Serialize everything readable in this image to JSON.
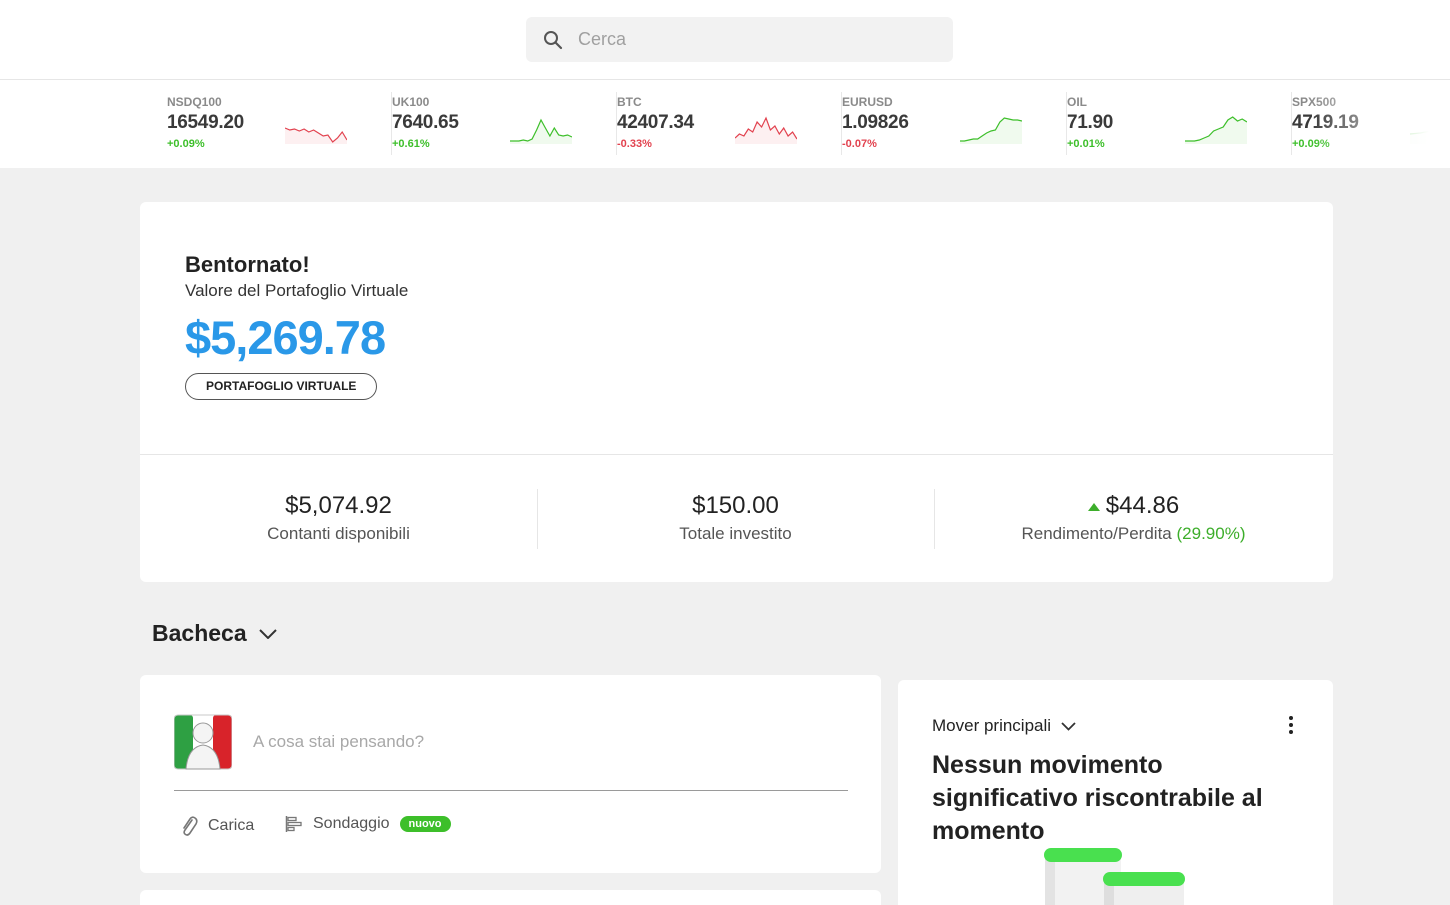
{
  "search": {
    "placeholder": "Cerca"
  },
  "ticker": [
    {
      "symbol": "NSDQ100",
      "price": "16549.20",
      "change": "+0.09%",
      "direction": "up",
      "spark_color": "#e2424f",
      "spark": [
        14,
        16,
        15,
        17,
        15,
        18,
        16,
        19,
        22,
        21,
        28,
        24,
        18,
        26
      ]
    },
    {
      "symbol": "UK100",
      "price": "7640.65",
      "change": "+0.61%",
      "direction": "up",
      "spark_color": "#3dbf2a",
      "spark": [
        27,
        27,
        27,
        26,
        27,
        25,
        16,
        6,
        14,
        22,
        14,
        21,
        22,
        21,
        23
      ]
    },
    {
      "symbol": "BTC",
      "price": "42407.34",
      "change": "-0.33%",
      "direction": "down",
      "spark_color": "#e2424f",
      "spark": [
        24,
        20,
        22,
        15,
        18,
        8,
        13,
        4,
        16,
        12,
        20,
        14,
        22,
        18,
        25
      ]
    },
    {
      "symbol": "EURUSD",
      "price": "1.09826",
      "change": "-0.07%",
      "direction": "down",
      "spark_color": "#3dbf2a",
      "spark": [
        27,
        27,
        26,
        25,
        25,
        22,
        19,
        17,
        16,
        8,
        4,
        5,
        6,
        6,
        7
      ]
    },
    {
      "symbol": "OIL",
      "price": "71.90",
      "change": "+0.01%",
      "direction": "up",
      "spark_color": "#3dbf2a",
      "spark": [
        27,
        27,
        27,
        26,
        24,
        22,
        17,
        15,
        13,
        6,
        3,
        7,
        5,
        8
      ]
    },
    {
      "symbol": "SPX500",
      "price": "4719.19",
      "change": "+0.09%",
      "direction": "up",
      "spark_color": "#3dbf2a",
      "spark": [
        20,
        19,
        17,
        15,
        12,
        10,
        8
      ]
    }
  ],
  "portfolio": {
    "greeting": "Bentornato!",
    "label": "Valore del Portafoglio Virtuale",
    "value": "$5,269.78",
    "pill": "PORTAFOGLIO VIRTUALE",
    "cash_value": "$5,074.92",
    "cash_label": "Contanti disponibili",
    "invested_value": "$150.00",
    "invested_label": "Totale investito",
    "pl_value": "$44.86",
    "pl_label": "Rendimento/Perdita",
    "pl_percent": "(29.90%)"
  },
  "feed": {
    "title": "Bacheca",
    "post_placeholder": "A cosa stai pensando?",
    "upload_label": "Carica",
    "poll_label": "Sondaggio",
    "poll_badge": "nuovo"
  },
  "movers": {
    "title": "Mover principali",
    "message": "Nessun movimento significativo riscontrabile al momento"
  },
  "colors": {
    "accent": "#2a98e8",
    "positive": "#3dbf2a",
    "negative": "#e2424f"
  }
}
